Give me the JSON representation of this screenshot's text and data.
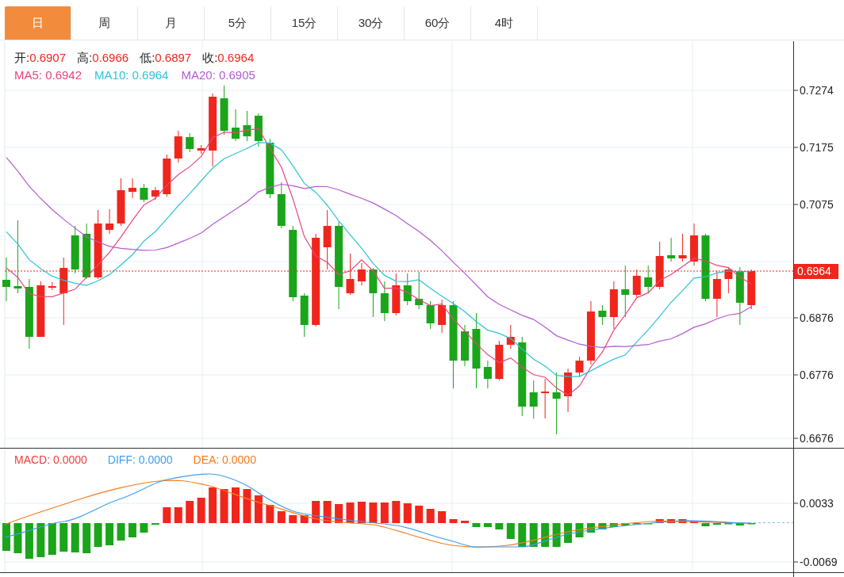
{
  "tabs": [
    {
      "label": "日",
      "selected": true
    },
    {
      "label": "周",
      "selected": false
    },
    {
      "label": "月",
      "selected": false
    },
    {
      "label": "5分",
      "selected": false
    },
    {
      "label": "15分",
      "selected": false
    },
    {
      "label": "30分",
      "selected": false
    },
    {
      "label": "60分",
      "selected": false
    },
    {
      "label": "4时",
      "selected": false
    }
  ],
  "ohlc": [
    {
      "label": "开:",
      "value": "0.6907"
    },
    {
      "label": "高:",
      "value": "0.6966"
    },
    {
      "label": "低:",
      "value": "0.6897"
    },
    {
      "label": "收:",
      "value": "0.6964"
    }
  ],
  "ma_legend": [
    {
      "label": "MA5:",
      "value": "0.6942",
      "color": "#e8457c"
    },
    {
      "label": "MA10:",
      "value": "0.6964",
      "color": "#2ec3d6"
    },
    {
      "label": "MA20:",
      "value": "0.6905",
      "color": "#b35bd0"
    }
  ],
  "price_axis": [
    "0.7274",
    "0.7175",
    "0.7075",
    "0.6876",
    "0.6776",
    "0.6676"
  ],
  "current_price": "0.6964",
  "macd_legend": [
    {
      "label": "MACD:",
      "value": "0.0000",
      "color": "#f03c3c"
    },
    {
      "label": "DIFF:",
      "value": "0.0000",
      "color": "#3a9ff0"
    },
    {
      "label": "DEA:",
      "value": "0.0000",
      "color": "#f57a1a"
    }
  ],
  "macd_axis": [
    "0.0033",
    "-0.0069"
  ]
}
